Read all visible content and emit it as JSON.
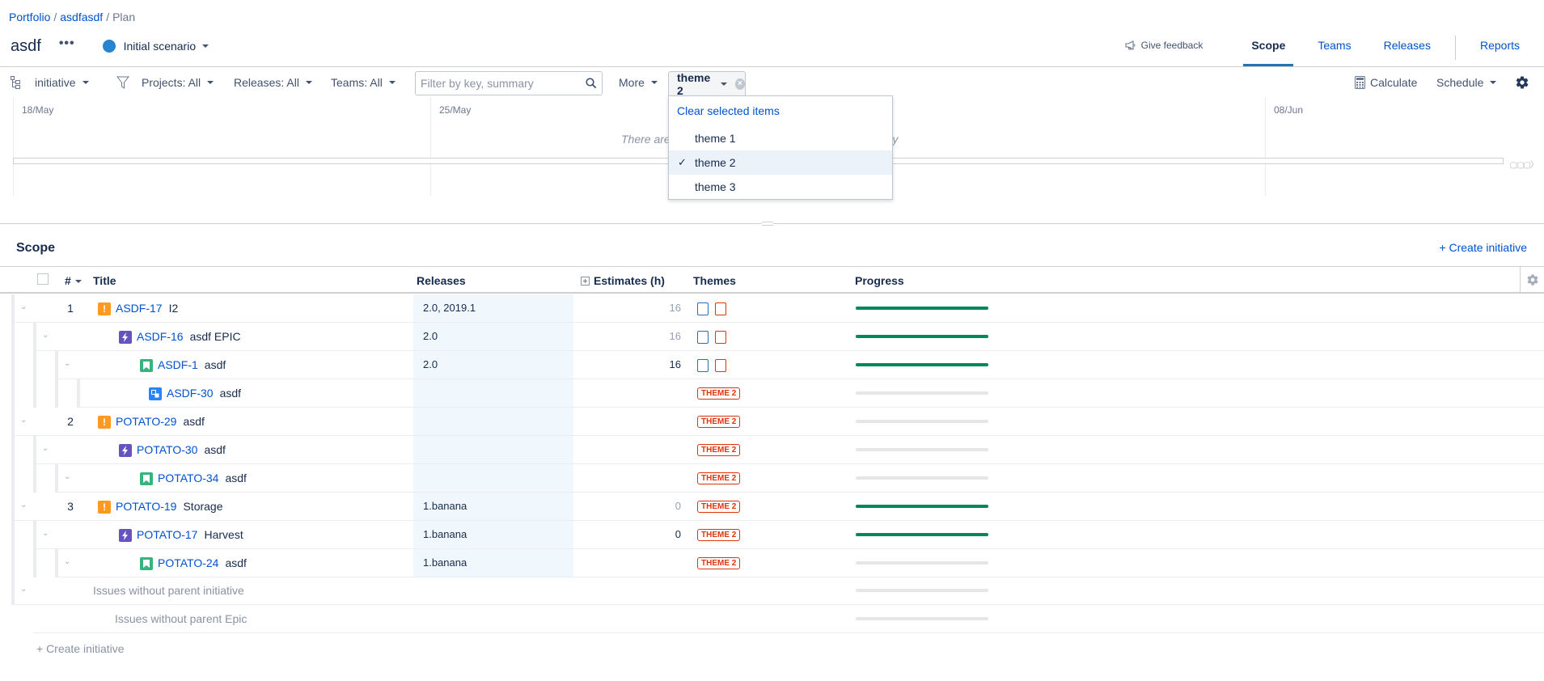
{
  "breadcrumb": {
    "items": [
      "Portfolio",
      "asdfasdf"
    ],
    "current": "Plan",
    "separator": "/"
  },
  "header": {
    "plan_title": "asdf",
    "more_label": "•••",
    "scenario_label": "Initial scenario",
    "scenario_color": "#2684d0",
    "feedback_label": "Give feedback",
    "tabs": [
      {
        "label": "Scope",
        "active": true
      },
      {
        "label": "Teams",
        "active": false
      },
      {
        "label": "Releases",
        "active": false
      },
      {
        "label": "Reports",
        "active": false
      }
    ]
  },
  "toolbar": {
    "hierarchy_label": "initiative",
    "projects_filter": "Projects: All",
    "releases_filter": "Releases: All",
    "teams_filter": "Teams: All",
    "search_placeholder": "Filter by key, summary",
    "search_value": "",
    "more_label": "More",
    "theme_chip_label": "theme 2",
    "calculate_label": "Calculate",
    "schedule_label": "Schedule"
  },
  "theme_dropdown": {
    "clear_label": "Clear selected items",
    "options": [
      {
        "label": "theme 1",
        "selected": false
      },
      {
        "label": "theme 2",
        "selected": true
      },
      {
        "label": "theme 3",
        "selected": false
      }
    ]
  },
  "timeline": {
    "dates": [
      "18/May",
      "25/May",
      "08/Jun"
    ],
    "message": "There are no issues to display in the selected hierarchy"
  },
  "scope": {
    "title": "Scope",
    "create_initiative_label": "+ Create initiative",
    "columns": [
      "#",
      "Title",
      "Releases",
      "Estimates (h)",
      "Themes",
      "Progress"
    ],
    "rows": [
      {
        "level": 0,
        "rank": "1",
        "type": "initiative",
        "key": "ASDF-17",
        "summary": "I2",
        "releases": "2.0, 2019.1",
        "estimate": "16",
        "estimate_rollup": true,
        "themes": "boxes",
        "progress": 1.0
      },
      {
        "level": 1,
        "rank": "",
        "type": "epic",
        "key": "ASDF-16",
        "summary": "asdf EPIC",
        "releases": "2.0",
        "estimate": "16",
        "estimate_rollup": true,
        "themes": "boxes",
        "progress": 1.0
      },
      {
        "level": 2,
        "rank": "",
        "type": "story",
        "key": "ASDF-1",
        "summary": "asdf",
        "releases": "2.0",
        "estimate": "16",
        "estimate_rollup": false,
        "themes": "boxes",
        "progress": 1.0
      },
      {
        "level": 3,
        "rank": "",
        "type": "subtask",
        "key": "ASDF-30",
        "summary": "asdf",
        "releases": "",
        "estimate": "",
        "estimate_rollup": false,
        "themes": "THEME 2",
        "progress": 0
      },
      {
        "level": 0,
        "rank": "2",
        "type": "initiative",
        "key": "POTATO-29",
        "summary": "asdf",
        "releases": "",
        "estimate": "",
        "estimate_rollup": false,
        "themes": "THEME 2",
        "progress": 0
      },
      {
        "level": 1,
        "rank": "",
        "type": "epic",
        "key": "POTATO-30",
        "summary": "asdf",
        "releases": "",
        "estimate": "",
        "estimate_rollup": false,
        "themes": "THEME 2",
        "progress": 0
      },
      {
        "level": 2,
        "rank": "",
        "type": "story",
        "key": "POTATO-34",
        "summary": "asdf",
        "releases": "",
        "estimate": "",
        "estimate_rollup": false,
        "themes": "THEME 2",
        "progress": 0
      },
      {
        "level": 0,
        "rank": "3",
        "type": "initiative",
        "key": "POTATO-19",
        "summary": "Storage",
        "releases": "1.banana",
        "estimate": "0",
        "estimate_rollup": true,
        "themes": "THEME 2",
        "progress": 1.0
      },
      {
        "level": 1,
        "rank": "",
        "type": "epic",
        "key": "POTATO-17",
        "summary": "Harvest",
        "releases": "1.banana",
        "estimate": "0",
        "estimate_rollup": false,
        "themes": "THEME 2",
        "progress": 1.0
      },
      {
        "level": 2,
        "rank": "",
        "type": "story",
        "key": "POTATO-24",
        "summary": "asdf",
        "releases": "1.banana",
        "estimate": "",
        "estimate_rollup": false,
        "themes": "THEME 2",
        "progress": 0
      }
    ],
    "orphan_initiative_label": "Issues without parent initiative",
    "orphan_epic_label": "Issues without parent Epic",
    "create_initiative_bottom_label": "+ Create initiative"
  },
  "colors": {
    "link": "#0052cc",
    "initiative": "#ff991f",
    "epic": "#6554c0",
    "story": "#36b37e",
    "subtask": "#2684ff",
    "progress_done": "#00875a",
    "theme_red": "#de350b",
    "theme_blue": "#2571b5"
  }
}
